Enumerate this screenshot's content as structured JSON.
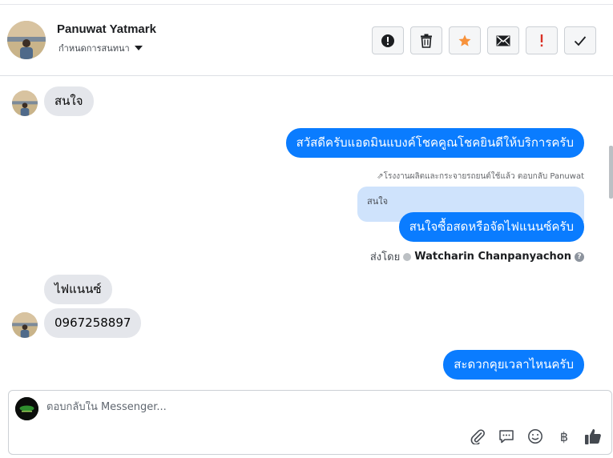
{
  "header": {
    "contact_name": "Panuwat Yatmark",
    "assign_label": "กำหนดการสนทนา",
    "actions": [
      {
        "icon": "exclamation-circle-icon",
        "label": "report"
      },
      {
        "icon": "trash-icon",
        "label": "delete"
      },
      {
        "icon": "star-icon",
        "label": "star"
      },
      {
        "icon": "envelope-icon",
        "label": "mark unread"
      },
      {
        "icon": "exclamation-icon",
        "label": "follow up"
      },
      {
        "icon": "checkmark-icon",
        "label": "done"
      }
    ]
  },
  "colors": {
    "outgoing_bubble": "#0a7cff",
    "incoming_bubble": "#e4e6eb",
    "star": "#f7923b",
    "follow_up": "#d93025",
    "quoted_bg": "#cfe3fc"
  },
  "messages": [
    {
      "direction": "in",
      "text": "สนใจ",
      "avatar": true
    },
    {
      "direction": "out",
      "text": "สวัสดีครับแอดมินแบงค์โชคคูณโชคยินดีให้บริการครับ"
    },
    {
      "direction": "out",
      "reply_meta": "โรงงานผลิตและกระจายรถยนต์ใช้แล้ว ตอบกลับ Panuwat",
      "quoted_text": "สนใจ",
      "text": "สนใจซื้อสดหรือจัดไฟแนนซ์ครับ"
    },
    {
      "direction": "in",
      "text": "ไฟแนนซ์"
    },
    {
      "direction": "in",
      "text": "0967258897",
      "avatar": true
    },
    {
      "direction": "out",
      "text": "สะดวกคุยเวลาไหนครับ"
    }
  ],
  "sent_by": {
    "prefix": "ส่งโดย",
    "agent": "Watcharin Chanpanyachon"
  },
  "composer": {
    "placeholder": "ตอบกลับใน Messenger...",
    "value": "",
    "tools": [
      "paperclip-icon",
      "saved-reply-icon",
      "emoji-icon",
      "baht-icon",
      "thumbs-up-icon"
    ],
    "baht_symbol": "฿"
  }
}
